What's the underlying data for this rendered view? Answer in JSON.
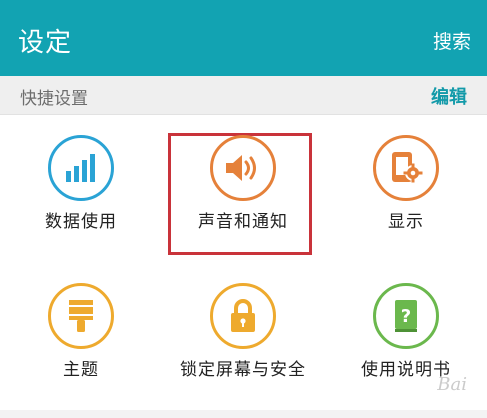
{
  "app_bar": {
    "title": "设定",
    "search_label": "搜索",
    "background": "#12a3b2"
  },
  "quick_settings": {
    "title": "快捷设置",
    "edit_label": "编辑"
  },
  "tiles": [
    {
      "id": "data-usage",
      "label": "数据使用",
      "icon": "bar-chart-icon",
      "color": "#2aa3d5"
    },
    {
      "id": "sound-notifications",
      "label": "声音和通知",
      "icon": "speaker-icon",
      "color": "#e5813a",
      "selected": true
    },
    {
      "id": "display",
      "label": "显示",
      "icon": "display-settings-icon",
      "color": "#e5813a"
    },
    {
      "id": "theme",
      "label": "主题",
      "icon": "paintbrush-icon",
      "color": "#eeaa2e"
    },
    {
      "id": "lock-screen-security",
      "label": "锁定屏幕与安全",
      "icon": "lock-icon",
      "color": "#eeaa2e"
    },
    {
      "id": "user-manual",
      "label": "使用说明书",
      "icon": "help-book-icon",
      "color": "#6bb84d"
    }
  ],
  "watermark": "Bai"
}
